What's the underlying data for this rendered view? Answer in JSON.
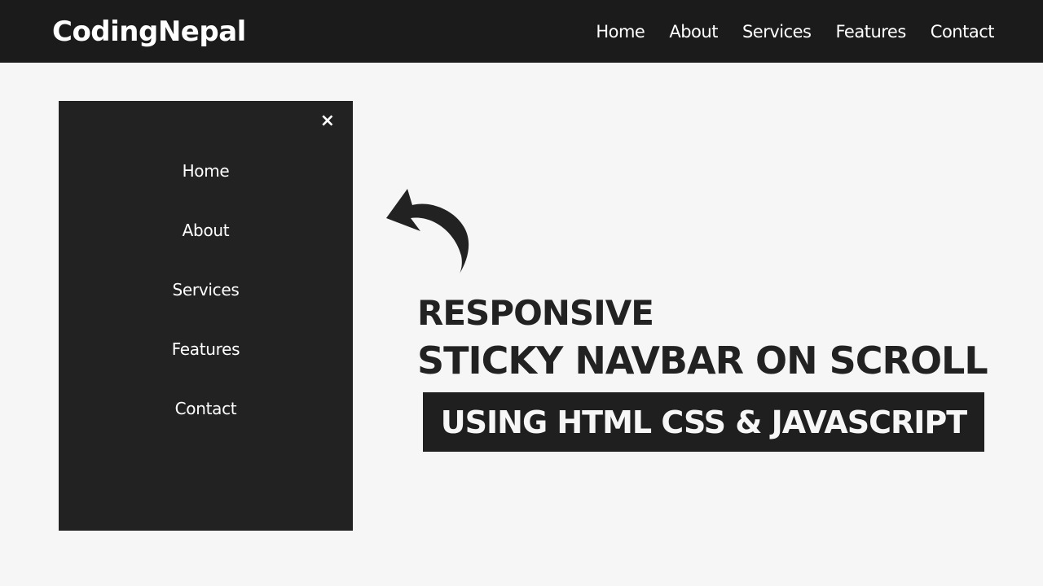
{
  "header": {
    "logo": "CodingNepal",
    "nav": [
      "Home",
      "About",
      "Services",
      "Features",
      "Contact"
    ]
  },
  "side_menu": {
    "close_icon": "×",
    "items": [
      "Home",
      "About",
      "Services",
      "Features",
      "Contact"
    ]
  },
  "arrow_icon": "curved-arrow-left",
  "headline": {
    "line1": "RESPONSIVE",
    "line2": "STICKY NAVBAR ON SCROLL",
    "banner": "USING HTML CSS & JAVASCRIPT"
  },
  "colors": {
    "topbar": "#1b1b1b",
    "panel": "#222222",
    "background": "#f6f6f6",
    "text_light": "#ffffff",
    "text_dark": "#222222"
  }
}
